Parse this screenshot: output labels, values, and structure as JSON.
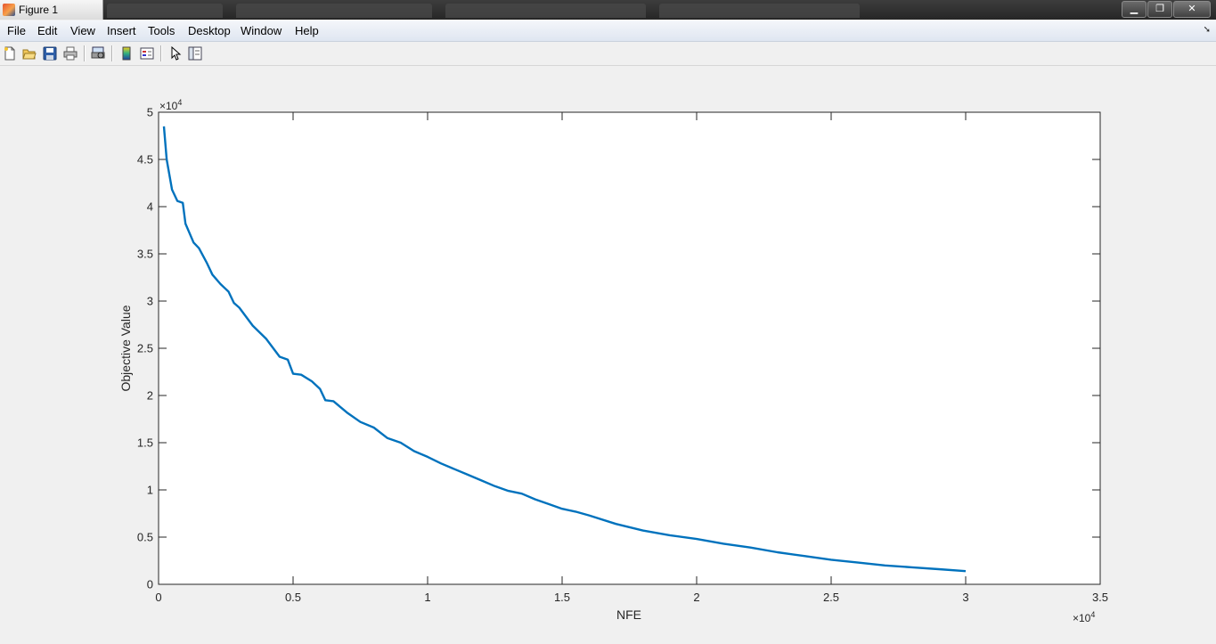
{
  "window": {
    "title": "Figure 1"
  },
  "menu": [
    "File",
    "Edit",
    "View",
    "Insert",
    "Tools",
    "Desktop",
    "Window",
    "Help"
  ],
  "window_buttons": {
    "minimize": "▁",
    "restore": "❐",
    "close": "✕"
  },
  "toolbar": {
    "icons": [
      "new-figure-icon",
      "open-file-icon",
      "save-icon",
      "print-icon",
      "print-preview-icon",
      "colorbar-icon",
      "legend-icon",
      "pointer-icon",
      "plot-browser-icon"
    ]
  },
  "chart_data": {
    "type": "line",
    "xlabel": "NFE",
    "ylabel": "Objective Value",
    "x_multiplier_label": "×10",
    "x_multiplier_exp": "4",
    "y_multiplier_label": "×10",
    "y_multiplier_exp": "4",
    "xlim": [
      0,
      35000
    ],
    "ylim": [
      0,
      50000
    ],
    "xticks": [
      0,
      5000,
      10000,
      15000,
      20000,
      25000,
      30000,
      35000
    ],
    "xtick_labels": [
      "0",
      "0.5",
      "1",
      "1.5",
      "2",
      "2.5",
      "3",
      "3.5"
    ],
    "yticks": [
      0,
      5000,
      10000,
      15000,
      20000,
      25000,
      30000,
      35000,
      40000,
      45000,
      50000
    ],
    "ytick_labels": [
      "0",
      "0.5",
      "1",
      "1.5",
      "2",
      "2.5",
      "3",
      "3.5",
      "4",
      "4.5",
      "5"
    ],
    "line_color": "#0072bd",
    "series": [
      {
        "x": [
          200,
          300,
          500,
          700,
          900,
          1000,
          1300,
          1500,
          1800,
          2000,
          2300,
          2600,
          2800,
          3000,
          3500,
          4000,
          4500,
          4800,
          5000,
          5300,
          5700,
          6000,
          6200,
          6500,
          7000,
          7500,
          8000,
          8500,
          9000,
          9500,
          10000,
          10500,
          11000,
          11500,
          12000,
          12500,
          13000,
          13500,
          14000,
          14500,
          15000,
          15500,
          16000,
          17000,
          18000,
          19000,
          20000,
          21000,
          22000,
          23000,
          24000,
          25000,
          26000,
          27000,
          28000,
          29000,
          30000
        ],
        "y": [
          48500,
          45000,
          41800,
          40600,
          40400,
          38200,
          36200,
          35600,
          34000,
          32800,
          31800,
          31000,
          29800,
          29300,
          27400,
          26000,
          24100,
          23800,
          22300,
          22200,
          21500,
          20700,
          19500,
          19400,
          18200,
          17200,
          16600,
          15500,
          15000,
          14100,
          13500,
          12800,
          12200,
          11600,
          11000,
          10400,
          9900,
          9600,
          9000,
          8500,
          8000,
          7700,
          7300,
          6400,
          5700,
          5200,
          4800,
          4300,
          3900,
          3400,
          3000,
          2600,
          2300,
          2000,
          1800,
          1600,
          1400
        ]
      }
    ]
  }
}
